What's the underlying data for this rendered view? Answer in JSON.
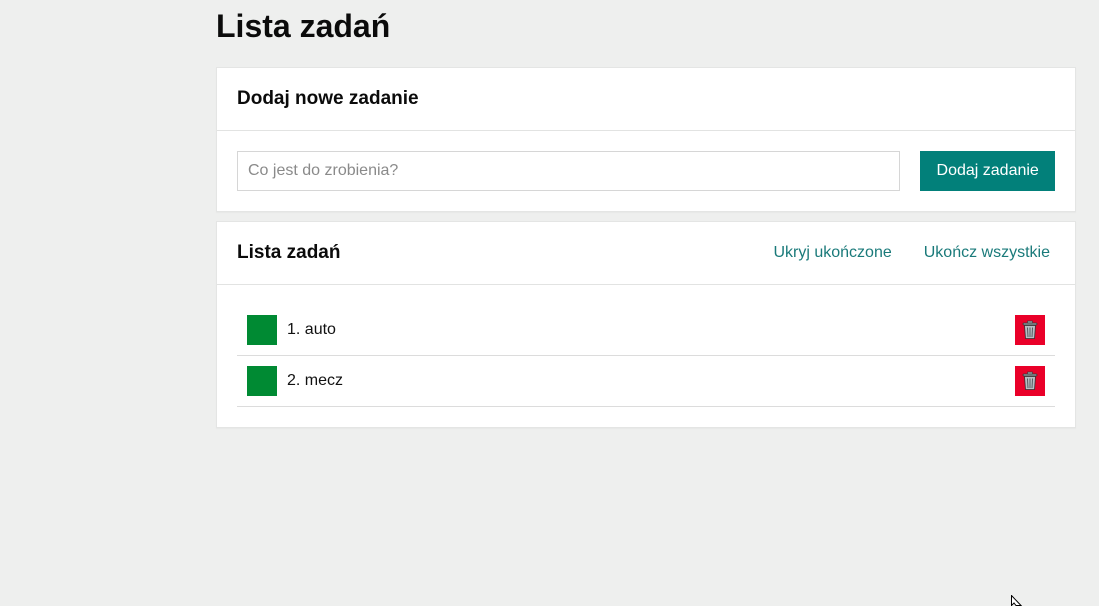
{
  "page": {
    "title": "Lista zadań"
  },
  "add_card": {
    "title": "Dodaj nowe zadanie",
    "input_value": "",
    "input_placeholder": "Co jest do zrobienia?",
    "button_label": "Dodaj zadanie"
  },
  "list_card": {
    "title": "Lista zadań",
    "hide_completed_label": "Ukryj ukończone",
    "complete_all_label": "Ukończ wszystkie",
    "tasks": [
      {
        "label": "1. auto",
        "check_color": "#008a33",
        "delete_icon": "trash-icon"
      },
      {
        "label": "2. mecz",
        "check_color": "#008a33",
        "delete_icon": "trash-icon"
      }
    ]
  },
  "colors": {
    "accent": "#02807a",
    "link": "#1a7a7a",
    "done": "#008a33",
    "delete": "#ea0029",
    "background": "#eeefee"
  }
}
